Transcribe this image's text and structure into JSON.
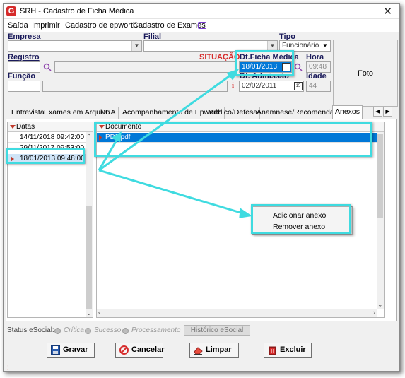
{
  "window": {
    "title": "SRH - Cadastro de Ficha Médica",
    "app_icon_letter": "G",
    "close_glyph": "✕"
  },
  "menu": {
    "items": [
      "Saída",
      "Imprimir",
      "Cadastro de epworth",
      "Cadastro de Exames"
    ],
    "extra_icon": "window-icon"
  },
  "form": {
    "empresa_label": "Empresa",
    "filial_label": "Filial",
    "tipo_label": "Tipo",
    "tipo_value": "Funcionário",
    "registro_label": "Registro",
    "situacao_label": "SITUAÇÃO",
    "dt_ficha_label": "Dt.Ficha Médica",
    "dt_ficha_value": "18/01/2013",
    "hora_label": "Hora",
    "hora_value": "09:48",
    "funcao_label": "Função",
    "dt_admissao_label": "Dt. Admissão",
    "dt_admissao_value": "02/02/2011",
    "idade_label": "Idade",
    "idade_value": "44",
    "info_glyph": "i",
    "photo_label": "Foto"
  },
  "tabs": [
    {
      "label": "Entrevista"
    },
    {
      "label": "Exames em Arquivo"
    },
    {
      "label": "PCA"
    },
    {
      "label": "Acompanhamento de Epworth"
    },
    {
      "label": "Médico/Defesa"
    },
    {
      "label": "Anamnese/Recomendação"
    },
    {
      "label": "Anexos"
    }
  ],
  "active_tab": "Anexos",
  "dates_grid": {
    "header": "Datas",
    "rows": [
      "14/11/2018 09:42:00",
      "29/11/2017 09:53:00",
      "18/01/2013 09:48:00"
    ],
    "selected_index": 2
  },
  "docs_grid": {
    "header": "Documento",
    "rows": [
      "PDF.pdf"
    ],
    "selected_index": 0
  },
  "context_menu": {
    "items": [
      "Adicionar anexo",
      "Remover anexo"
    ]
  },
  "status_esocial": {
    "label": "Status eSocial:",
    "options": [
      "Crítica",
      "Sucesso",
      "Processamento"
    ],
    "history_button": "Histórico eSocial"
  },
  "actions": {
    "save": "Gravar",
    "cancel": "Cancelar",
    "clear": "Limpar",
    "delete": "Excluir"
  },
  "bottom_status": "!",
  "colors": {
    "highlight": "#3fdbe0",
    "selection": "#0078d7",
    "situacao": "#d62b2b",
    "marker": "#c0392b"
  }
}
